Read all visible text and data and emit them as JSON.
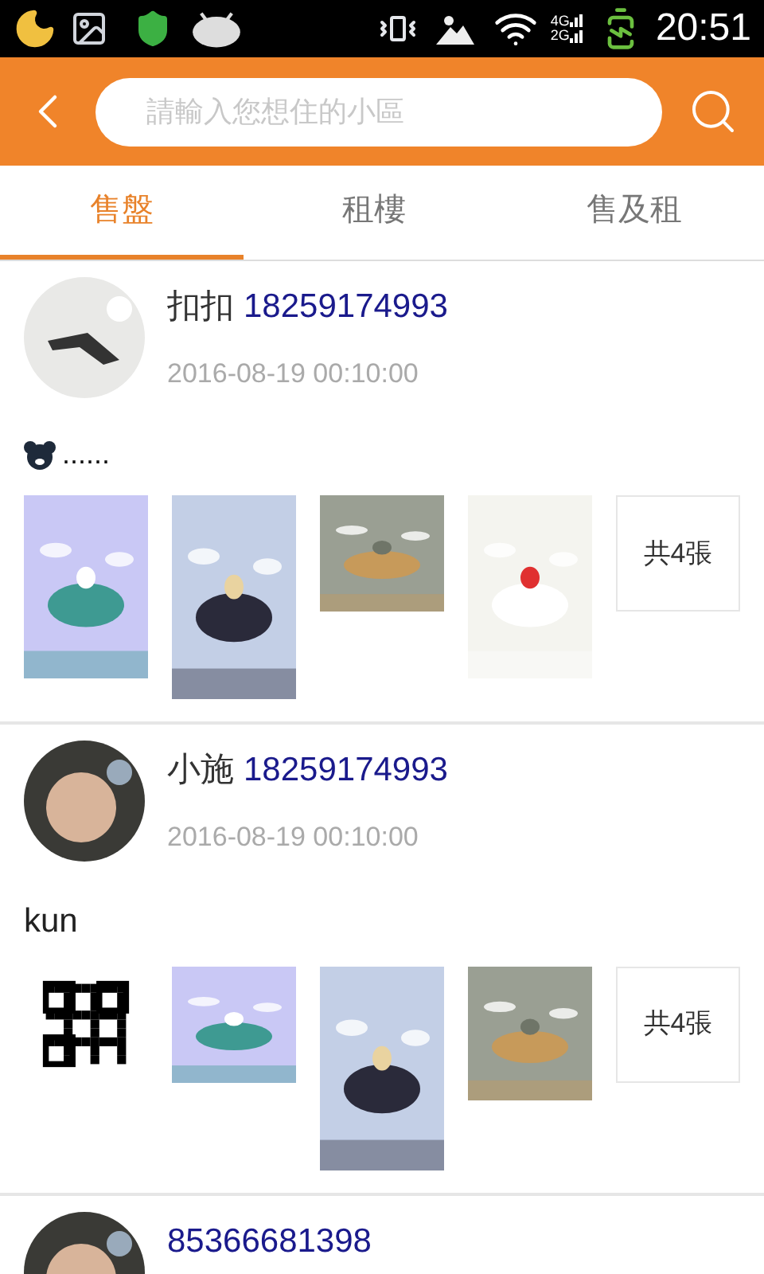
{
  "status_bar": {
    "networks": [
      "4G",
      "2G"
    ],
    "time": "20:51"
  },
  "search": {
    "placeholder": "請輸入您想住的小區"
  },
  "tabs": [
    {
      "label": "售盤",
      "selected": true
    },
    {
      "label": "租樓",
      "selected": false
    },
    {
      "label": "售及租",
      "selected": false
    }
  ],
  "posts": [
    {
      "name": "扣扣",
      "phone": "18259174993",
      "time": "2016-08-19 00:10:00",
      "emoji": true,
      "text": "......",
      "images": [
        {
          "kind": "picture"
        },
        {
          "kind": "picture"
        },
        {
          "kind": "picture"
        },
        {
          "kind": "picture"
        }
      ],
      "count": "共4張"
    },
    {
      "name": "小施",
      "phone": "18259174993",
      "time": "2016-08-19 00:10:00",
      "emoji": false,
      "text": "kun",
      "images": [
        {
          "kind": "qr"
        },
        {
          "kind": "picture"
        },
        {
          "kind": "picture"
        },
        {
          "kind": "picture"
        }
      ],
      "count": "共4張"
    },
    {
      "phone": "85366681398"
    }
  ]
}
